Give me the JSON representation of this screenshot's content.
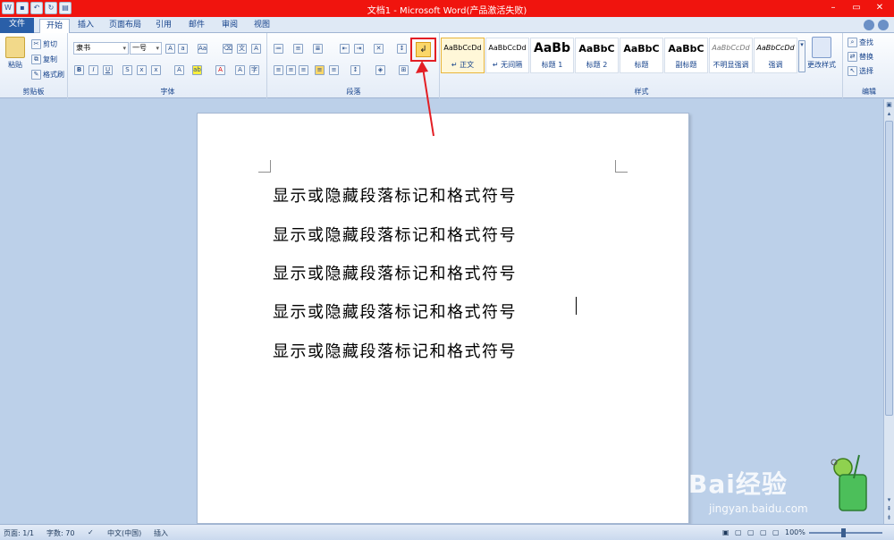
{
  "window": {
    "title": "文档1 - Microsoft Word(产品激活失败)"
  },
  "tabs": [
    {
      "label": "文件"
    },
    {
      "label": "开始"
    },
    {
      "label": "插入"
    },
    {
      "label": "页面布局"
    },
    {
      "label": "引用"
    },
    {
      "label": "邮件"
    },
    {
      "label": "审阅"
    },
    {
      "label": "视图"
    }
  ],
  "clipboard": {
    "paste": "粘贴",
    "cut": "剪切",
    "copy": "复制",
    "format_painter": "格式刷",
    "group": "剪贴板"
  },
  "font": {
    "name": "隶书",
    "size": "一号",
    "group": "字体"
  },
  "paragraph": {
    "group": "段落",
    "show_marks_glyph": "↲"
  },
  "styles": {
    "group": "样式",
    "items": [
      {
        "sample": "AaBbCcDd",
        "name": "↵ 正文"
      },
      {
        "sample": "AaBbCcDd",
        "name": "↵ 无间隔"
      },
      {
        "sample": "AaBb",
        "name": "标题 1"
      },
      {
        "sample": "AaBbC",
        "name": "标题 2"
      },
      {
        "sample": "AaBbC",
        "name": "标题"
      },
      {
        "sample": "AaBbC",
        "name": "副标题"
      },
      {
        "sample": "AaBbCcDd",
        "name": "不明显强调"
      },
      {
        "sample": "AaBbCcDd",
        "name": "强调"
      }
    ],
    "change_styles": "更改样式"
  },
  "editing": {
    "group": "编辑",
    "find": "查找",
    "replace": "替换",
    "select": "选择"
  },
  "document": {
    "lines": [
      "显示或隐藏段落标记和格式符号",
      "显示或隐藏段落标记和格式符号",
      "显示或隐藏段落标记和格式符号",
      "显示或隐藏段落标记和格式符号",
      "显示或隐藏段落标记和格式符号"
    ]
  },
  "status": {
    "page": "页面: 1/1",
    "words": "字数: 70",
    "language": "中文(中国)",
    "insert_mode": "插入",
    "zoom": "100%"
  },
  "watermark": {
    "brand": "Bai经验",
    "url": "jingyan.baidu.com"
  },
  "colors": {
    "titlebar": "#f0140e",
    "highlight": "#e31e24",
    "ribbon_text": "#15428b"
  }
}
